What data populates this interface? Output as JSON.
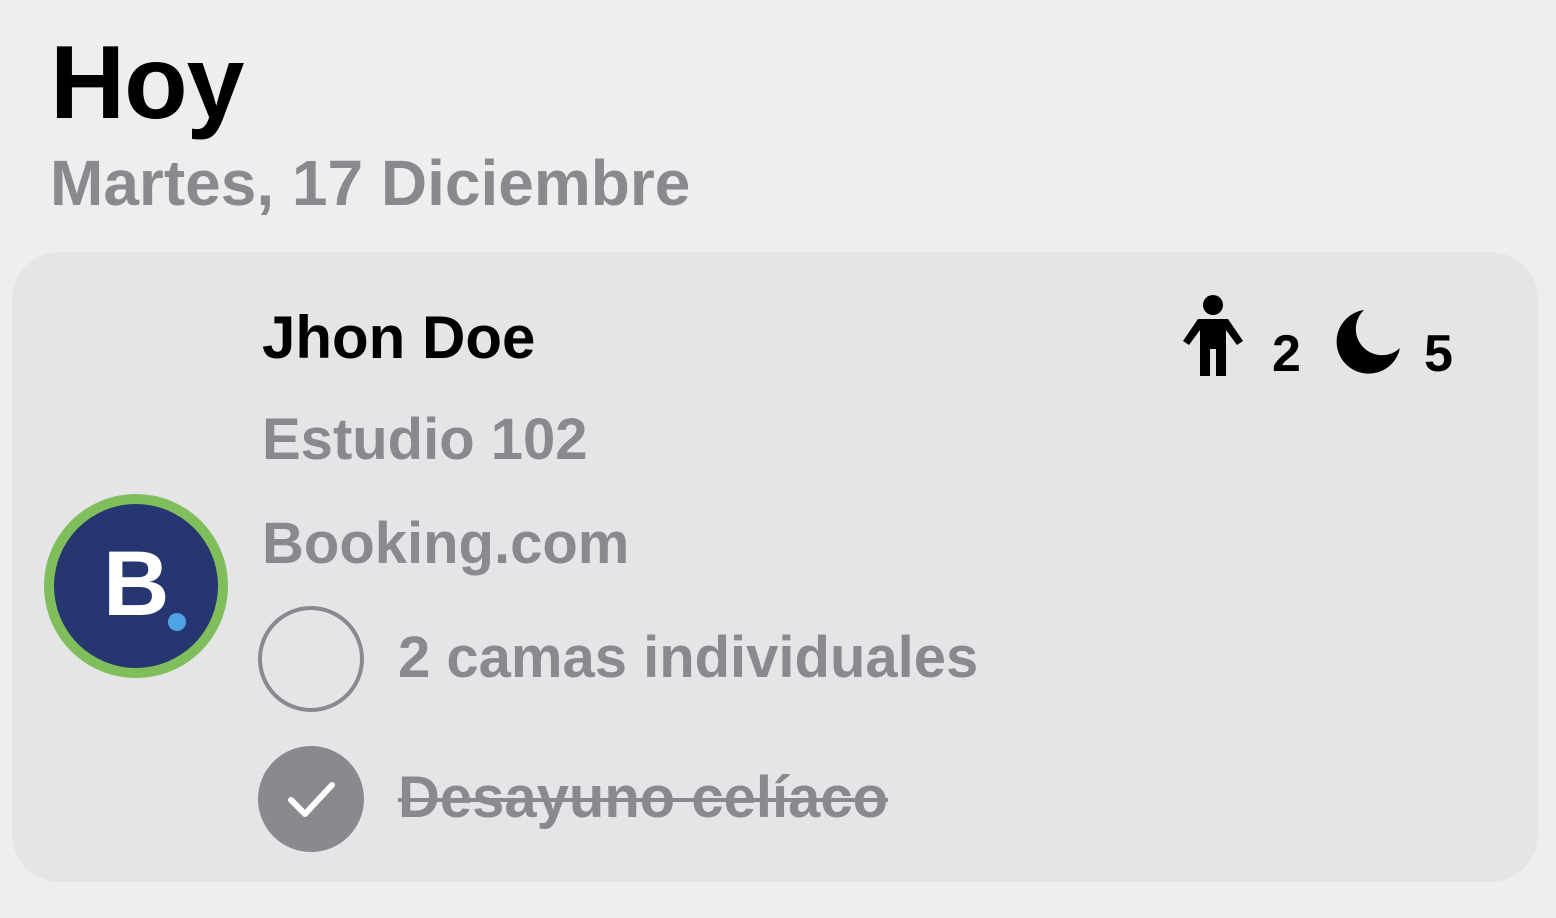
{
  "header": {
    "title": "Hoy",
    "date": "Martes, 17 Diciembre"
  },
  "reservation": {
    "guest_name": "Jhon Doe",
    "room": "Estudio 102",
    "source": "Booking.com",
    "source_logo_letter": "B",
    "guests": "2",
    "nights": "5",
    "icons": {
      "guests": "person-icon",
      "nights": "moon-icon",
      "checked": "checkmark-icon"
    },
    "tasks": [
      {
        "label": "2 camas individuales",
        "done": false
      },
      {
        "label": "Desayuno celíaco",
        "done": true
      }
    ]
  },
  "colors": {
    "background": "#eeeeef",
    "card": "#e5e4e6",
    "secondary_text": "#8a8a8e",
    "booking_blue": "#263670",
    "booking_dot": "#4ea3e4",
    "avatar_ring": "#7fbe5a"
  }
}
